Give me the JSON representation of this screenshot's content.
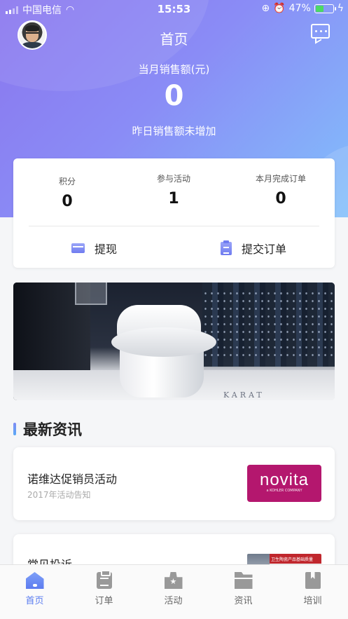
{
  "status_bar": {
    "carrier": "中国电信",
    "time": "15:53",
    "battery": "47%"
  },
  "header": {
    "title": "首页"
  },
  "sales": {
    "label": "当月销售额(元)",
    "value": "0",
    "note": "昨日销售额未增加"
  },
  "stats": [
    {
      "label": "积分",
      "value": "0"
    },
    {
      "label": "参与活动",
      "value": "1"
    },
    {
      "label": "本月完成订单",
      "value": "0"
    }
  ],
  "actions": {
    "withdraw": "提现",
    "submit_order": "提交订单"
  },
  "banner": {
    "brand_text": "KARAT"
  },
  "news": {
    "section_title": "最新资讯",
    "items": [
      {
        "title": "诺维达促销员活动",
        "subtitle": "2017年活动告知",
        "thumb_word": "novita",
        "thumb_sub": "a KOHLER COMPANY"
      },
      {
        "title": "常见投诉",
        "thumb_text": "卫生陶瓷产品基础质量"
      }
    ]
  },
  "tabbar": {
    "items": [
      {
        "label": "首页"
      },
      {
        "label": "订单"
      },
      {
        "label": "活动"
      },
      {
        "label": "资讯"
      },
      {
        "label": "培训"
      }
    ]
  },
  "colors": {
    "accent": "#5a7cf0",
    "hero_start": "#8a76ee",
    "hero_end": "#82c0fb",
    "novita": "#b4176e"
  }
}
